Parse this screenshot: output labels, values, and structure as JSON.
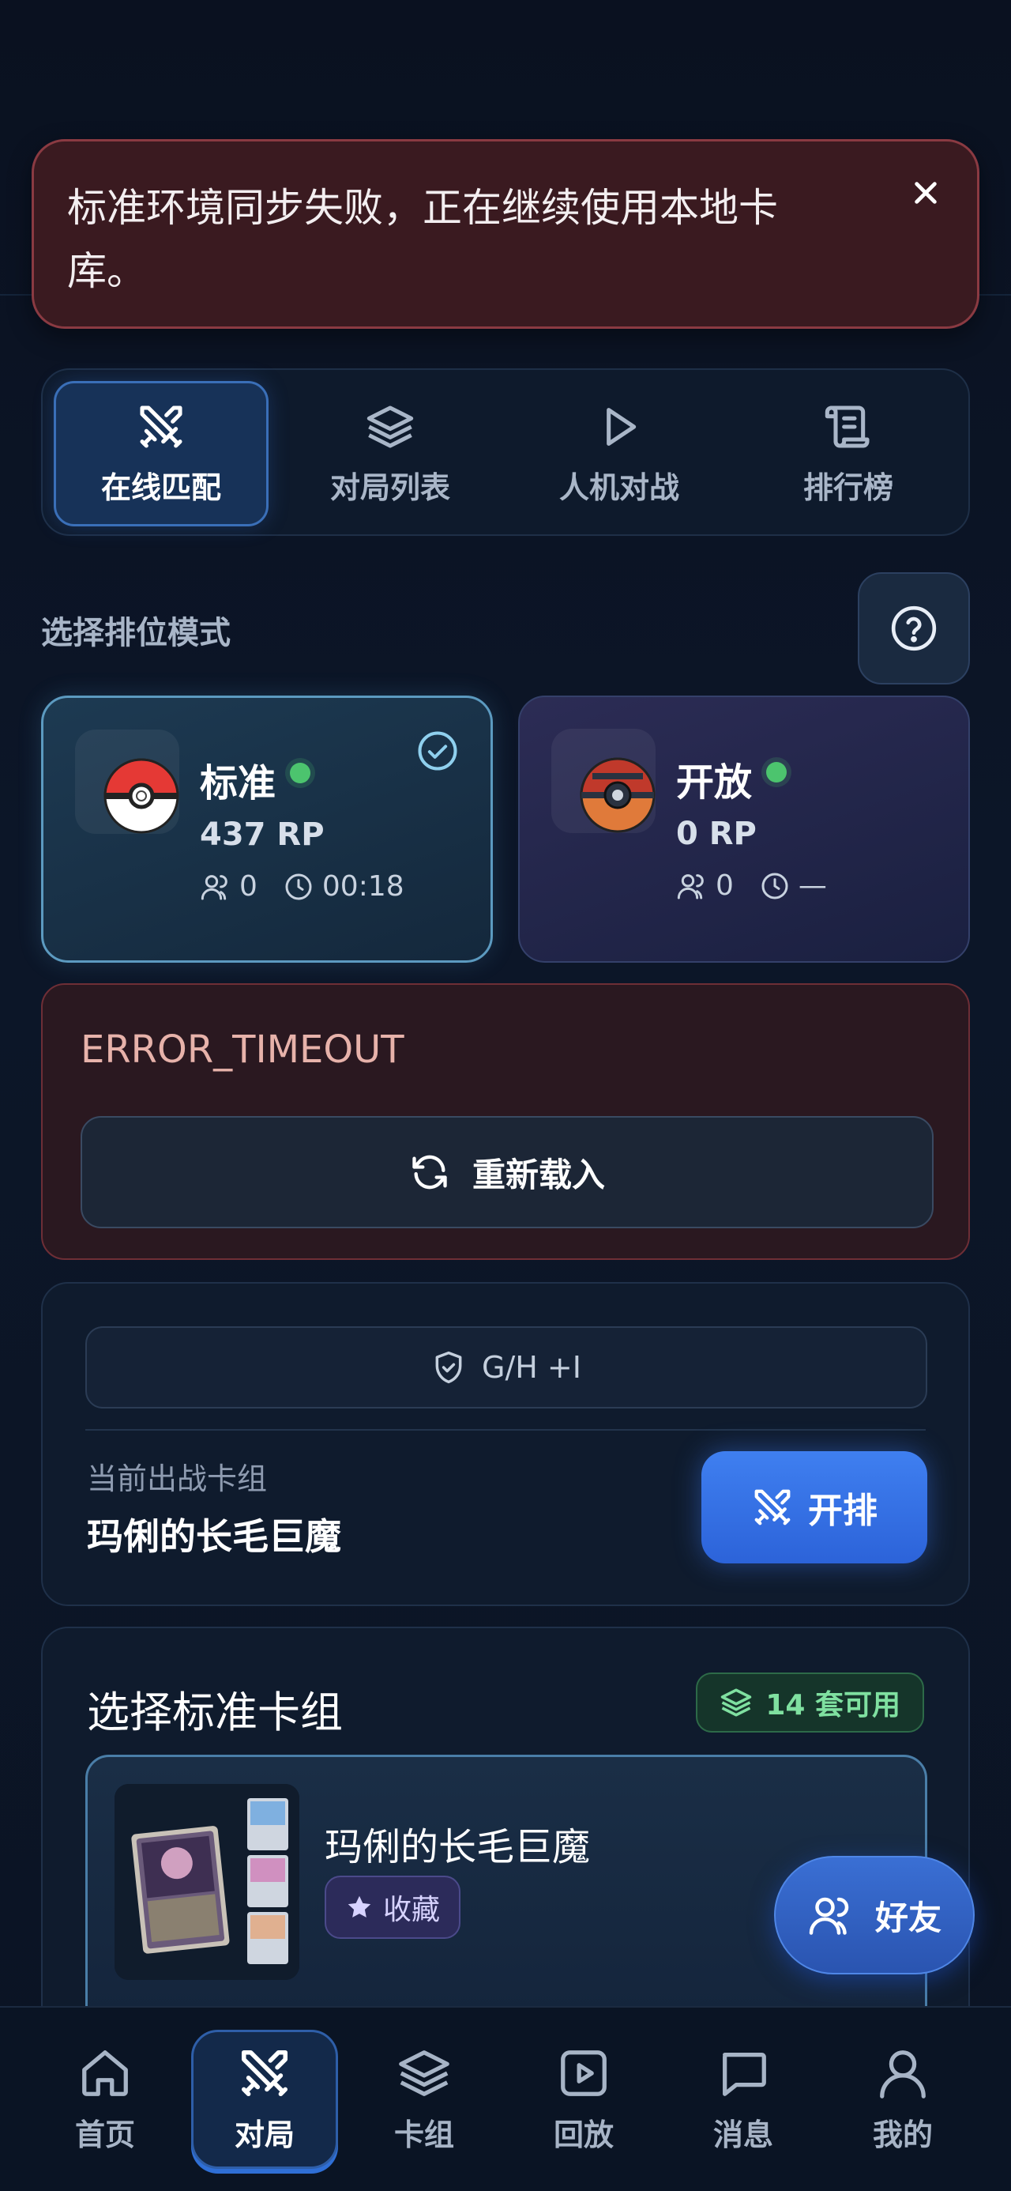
{
  "toast": {
    "message": "标准环境同步失败，正在继续使用本地卡库。"
  },
  "tabs": [
    {
      "label": "在线匹配",
      "icon": "crossed-swords-icon",
      "active": true
    },
    {
      "label": "对局列表",
      "icon": "layers-icon",
      "active": false
    },
    {
      "label": "人机对战",
      "icon": "play-icon",
      "active": false
    },
    {
      "label": "排行榜",
      "icon": "scroll-icon",
      "active": false
    }
  ],
  "mode_section": {
    "label": "选择排位模式"
  },
  "modes": {
    "standard": {
      "title": "标准",
      "rp": "437 RP",
      "players": "0",
      "time": "00:18",
      "selected": true
    },
    "open": {
      "title": "开放",
      "rp": "0 RP",
      "players": "0",
      "time": "—",
      "selected": false
    }
  },
  "error": {
    "code": "ERROR_TIMEOUT",
    "reload_label": "重新载入"
  },
  "match": {
    "format": "G/H +I",
    "current_deck_label": "当前出战卡组",
    "current_deck_name": "玛俐的长毛巨魔",
    "start_label": "开排"
  },
  "deck_select": {
    "title": "选择标准卡组",
    "count_label": "14 套可用",
    "items": [
      {
        "name": "玛俐的长毛巨魔",
        "badge": "收藏"
      }
    ]
  },
  "friends": {
    "label": "好友"
  },
  "bottom_nav": [
    {
      "label": "首页",
      "icon": "home-icon",
      "active": false
    },
    {
      "label": "对局",
      "icon": "crossed-swords-icon",
      "active": true
    },
    {
      "label": "卡组",
      "icon": "layers-icon",
      "active": false
    },
    {
      "label": "回放",
      "icon": "replay-icon",
      "active": false
    },
    {
      "label": "消息",
      "icon": "message-icon",
      "active": false
    },
    {
      "label": "我的",
      "icon": "user-icon",
      "active": false
    }
  ],
  "colors": {
    "accent": "#3f7ff0",
    "online_dot": "#4cc46e",
    "error_bg": "#3a1a20",
    "error_text": "#e7b2aa",
    "success_text": "#7fe0a0"
  }
}
